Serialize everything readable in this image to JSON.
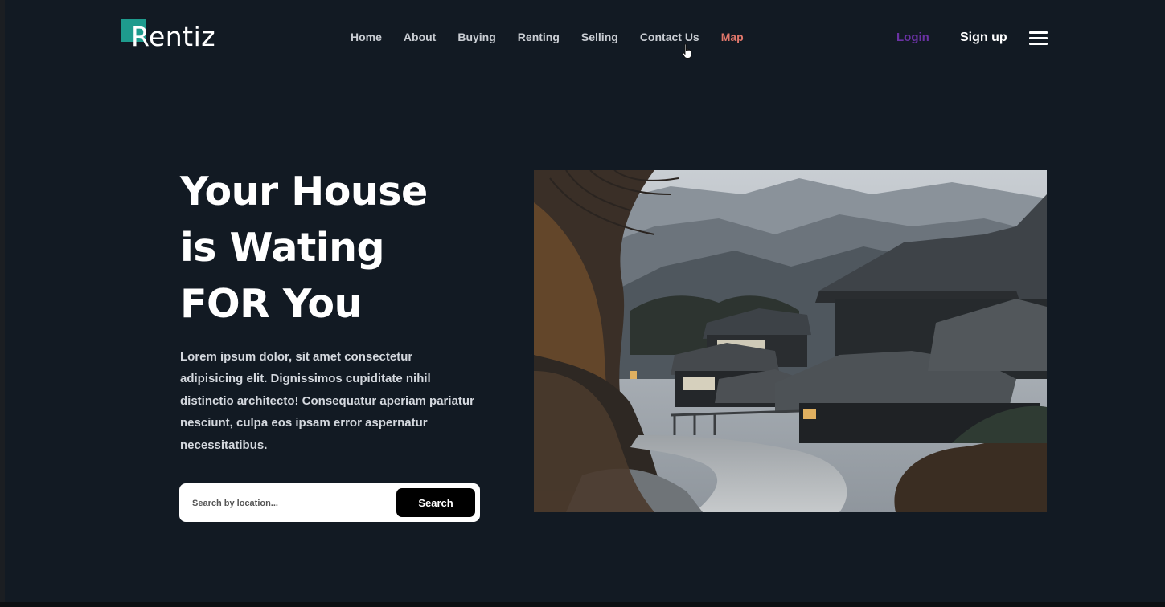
{
  "brand": {
    "name": "Rentiz",
    "accent": "#1e9b8d"
  },
  "nav": {
    "items": [
      {
        "label": "Home"
      },
      {
        "label": "About"
      },
      {
        "label": "Buying"
      },
      {
        "label": "Renting"
      },
      {
        "label": "Selling"
      },
      {
        "label": "Contact Us"
      },
      {
        "label": "Map",
        "color": "#e1776b"
      }
    ],
    "login_label": "Login",
    "signup_label": "Sign up",
    "menu_icon": "hamburger-menu-icon",
    "cursor_icon": "hand-pointer-icon"
  },
  "hero": {
    "title_lines": [
      "Your House",
      "is Wating",
      "FOR You"
    ],
    "description": "Lorem ipsum dolor, sit amet consectetur adipisicing elit. Dignissimos cupiditate nihil distinctio architecto! Consequatur aperiam pariatur nesciunt, culpa eos ipsam error aspernatur necessitatibus.",
    "search": {
      "placeholder": "Search by location...",
      "value": "",
      "button_label": "Search"
    }
  },
  "colors": {
    "background": "#121a23",
    "login": "#6a32a3"
  }
}
